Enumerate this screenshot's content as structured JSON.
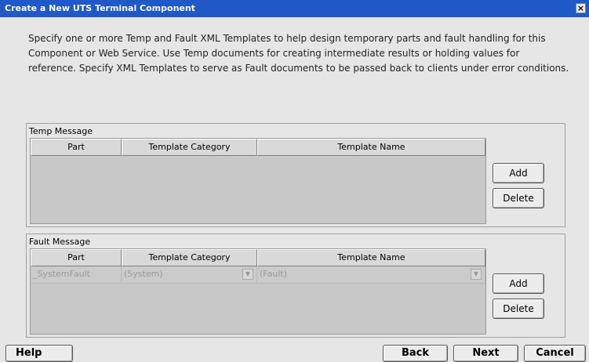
{
  "window": {
    "title": "Create a New UTS Terminal Component",
    "close_label": "×"
  },
  "description": "Specify one or more Temp and Fault XML Templates to help design temporary parts and fault handling for this Component or Web Service.  Use Temp documents for creating intermediate results or holding values for reference. Specify XML Templates to serve as Fault documents to be passed back to clients under error conditions.",
  "columns": [
    "Part",
    "Template Category",
    "Template Name"
  ],
  "temp_message": {
    "label": "Temp Message",
    "add_label": "Add",
    "delete_label": "Delete",
    "rows": []
  },
  "fault_message": {
    "label": "Fault Message",
    "add_label": "Add",
    "delete_label": "Delete",
    "rows": [
      {
        "part": "_SystemFault",
        "category": "(System)",
        "name": "(Fault)"
      }
    ]
  },
  "footer": {
    "help_label": "Help",
    "back_label": "Back",
    "next_label": "Next",
    "cancel_label": "Cancel"
  },
  "icons": {
    "dropdown": "chevron-down-icon"
  }
}
